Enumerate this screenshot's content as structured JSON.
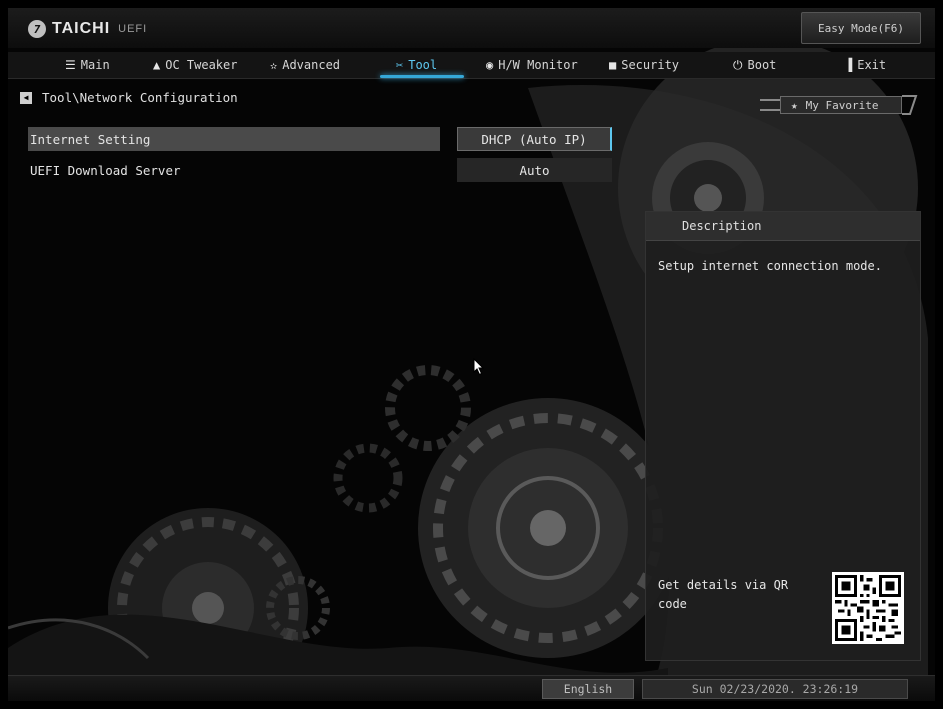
{
  "brand": {
    "name": "TAICHI",
    "sub": "UEFI"
  },
  "easy_mode_label": "Easy Mode(F6)",
  "nav": {
    "tabs": [
      {
        "label": "Main",
        "icon": "list-icon"
      },
      {
        "label": "OC Tweaker",
        "icon": "warning-icon"
      },
      {
        "label": "Advanced",
        "icon": "star-icon"
      },
      {
        "label": "Tool",
        "icon": "tool-icon",
        "active": true
      },
      {
        "label": "H/W Monitor",
        "icon": "monitor-icon"
      },
      {
        "label": "Security",
        "icon": "shield-icon"
      },
      {
        "label": "Boot",
        "icon": "power-icon"
      },
      {
        "label": "Exit",
        "icon": "exit-icon"
      }
    ]
  },
  "breadcrumb": "Tool\\Network Configuration",
  "my_favorite_label": "My Favorite",
  "settings": [
    {
      "label": "Internet Setting",
      "value": "DHCP (Auto IP)",
      "selected": true
    },
    {
      "label": "UEFI Download Server",
      "value": "Auto",
      "selected": false
    }
  ],
  "description": {
    "header": "Description",
    "text": "Setup internet connection mode.",
    "qr_text": "Get details via QR code"
  },
  "footer": {
    "language": "English",
    "datetime": "Sun 02/23/2020. 23:26:19"
  },
  "colors": {
    "accent": "#35a8d8",
    "background": "#000000",
    "panel": "#1e1e1e"
  }
}
